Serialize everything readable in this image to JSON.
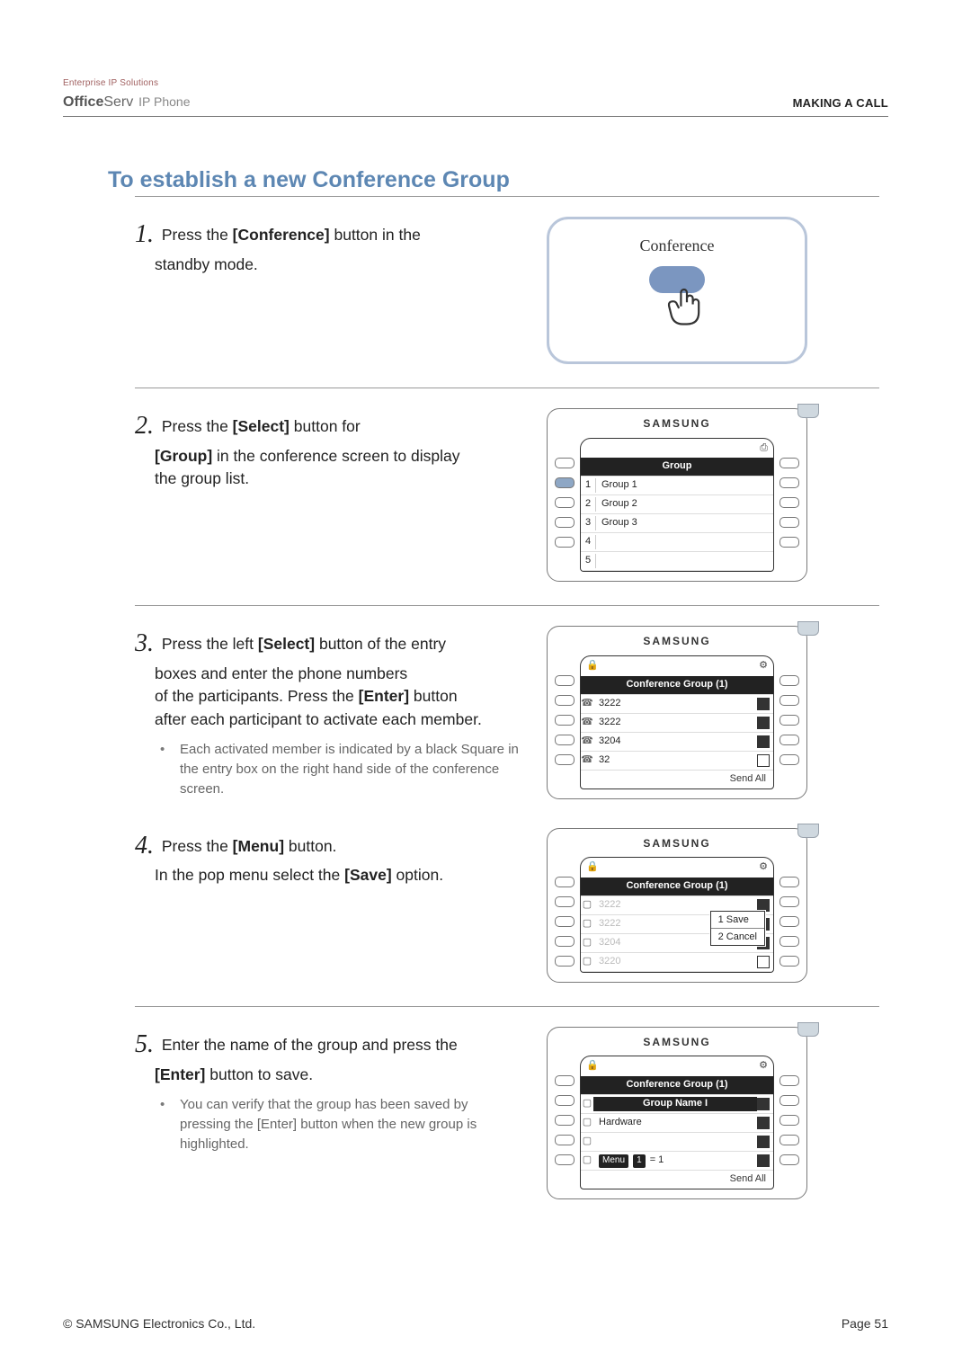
{
  "header": {
    "brand_small": "Enterprise IP Solutions",
    "brand_bold": "Office",
    "brand_rest": "Serv",
    "brand_sub": " IP Phone",
    "right": "MAKING A CALL"
  },
  "heading": "To establish a new Conference Group",
  "steps": {
    "s1": {
      "num": "1.",
      "a": "Press the ",
      "b1": "[Conference]",
      "c": " button in the",
      "d": "standby mode."
    },
    "s2": {
      "num": "2.",
      "a": "Press the ",
      "b1": "[Select]",
      "c": " button for",
      "d1": "[Group]",
      "e": " in the conference screen to display",
      "f": "the group list."
    },
    "s3": {
      "num": "3.",
      "a": "Press the left ",
      "b1": "[Select]",
      "c": " button of the entry",
      "d": "boxes and enter the phone numbers",
      "e": "of the participants. Press the ",
      "b2": "[Enter]",
      "f": " button",
      "g": "after each participant to activate each member.",
      "bullet": "Each activated member is indicated by a black Square in the entry box on the right hand side of the conference screen."
    },
    "s4": {
      "num": "4.",
      "a": "Press the ",
      "b1": "[Menu]",
      "c": " button.",
      "d": "In the pop menu select the ",
      "b2": "[Save]",
      "e": " option."
    },
    "s5": {
      "num": "5.",
      "a": "Enter the name of the group and press the",
      "b1": "[Enter]",
      "c": " button to save.",
      "bullet": "You can verify that the group has been saved by pressing the [Enter] button when the new group is highlighted."
    }
  },
  "shots": {
    "brand": "SAMSUNG",
    "s1_label": "Conference",
    "s2": {
      "title": "Group",
      "rows": [
        "Group 1",
        "Group 2",
        "Group 3",
        "",
        ""
      ],
      "topicon": "⎙"
    },
    "s3": {
      "title": "Conference Group (1)",
      "rows": [
        "3222",
        "3222",
        "3204",
        "32"
      ],
      "sendall": "Send All",
      "lock": "🔒",
      "gear": "⚙"
    },
    "s4": {
      "title": "Conference Group (1)",
      "rows": [
        "3222",
        "3222",
        "3204",
        "3220"
      ],
      "popup": [
        "1  Save",
        "2  Cancel"
      ],
      "lock": "🔒",
      "gear": "⚙"
    },
    "s5": {
      "title": "Conference Group (1)",
      "groupname_label": "Group Name I",
      "hardware": "Hardware",
      "menu": "Menu",
      "one": "1",
      "sendall": "Send All",
      "lock": "🔒",
      "gear": "⚙"
    }
  },
  "footer": {
    "left": "© SAMSUNG Electronics Co., Ltd.",
    "right": "Page 51"
  }
}
